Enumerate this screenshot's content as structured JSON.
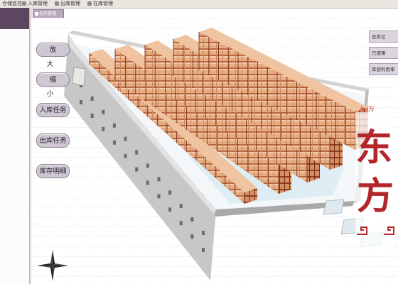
{
  "window": {
    "tabs": [
      {
        "label": "仓储监控"
      },
      {
        "label": "入库管理"
      },
      {
        "label": "出库管理"
      },
      {
        "label": "在库管理"
      }
    ],
    "view_tab": "仓库管理"
  },
  "actions": {
    "zoom_in": "放 大",
    "zoom_out": "缩 小",
    "inbound": "入库任务",
    "outbound": "出库任务",
    "inventory": "库存明细"
  },
  "legend": {
    "total": "总库位",
    "used": "已使用",
    "utilization": "库容利用率"
  },
  "logo": {
    "text": "东方",
    "small_top": "东方",
    "color": "#b3262a"
  },
  "colors": {
    "accent": "#5d4660",
    "button_bg": "#cfc7d1",
    "box": "#e2a57a",
    "rack": "#7e2a1c"
  },
  "icons": {
    "navigation": "compass-nav-icon"
  }
}
